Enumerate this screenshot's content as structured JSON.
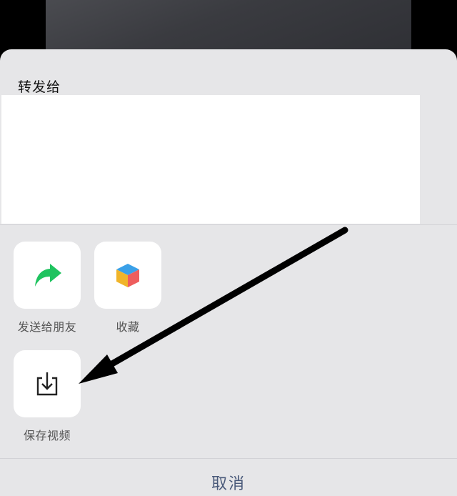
{
  "share_sheet": {
    "title": "转发给",
    "actions": [
      {
        "label": "发送给朋友",
        "icon": "forward-arrow-icon",
        "color": "#1fc35f"
      },
      {
        "label": "收藏",
        "icon": "favorites-cube-icon",
        "colors": [
          "#3aa0e8",
          "#f0b429",
          "#ee5d5d"
        ]
      },
      {
        "label": "保存视频",
        "icon": "download-tray-icon",
        "color": "#222222"
      }
    ],
    "cancel_label": "取消"
  },
  "annotation": {
    "icon": "pointer-arrow-annotation",
    "color": "#000000"
  }
}
